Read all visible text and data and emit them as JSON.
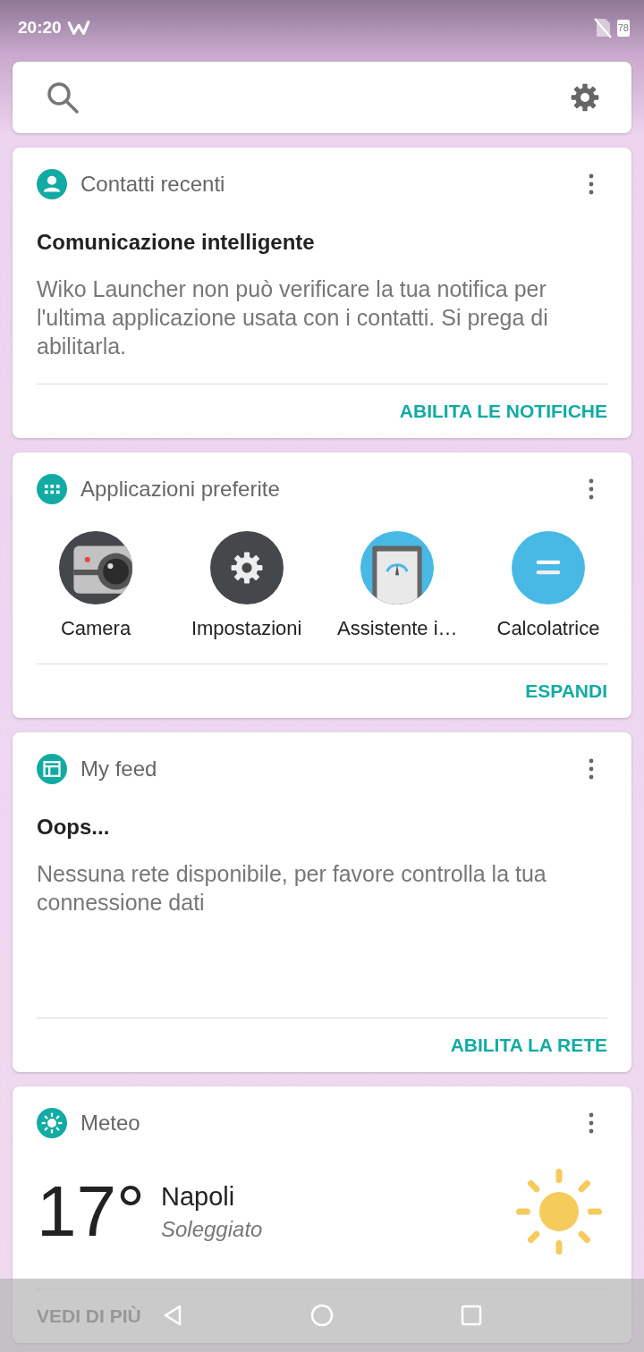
{
  "status_bar": {
    "time": "20:20",
    "battery": "78"
  },
  "cards": [
    {
      "kind": "contacts",
      "title": "Contatti recenti",
      "heading": "Comunicazione intelligente",
      "body": "Wiko Launcher non può verificare la tua notifica per l'ultima applicazione usata con i contatti. Si prega di abilitarla.",
      "action": "ABILITA LE NOTIFICHE"
    },
    {
      "kind": "apps",
      "title": "Applicazioni preferite",
      "apps": [
        {
          "kind": "camera",
          "label": "Camera"
        },
        {
          "kind": "settings",
          "label": "Impostazioni"
        },
        {
          "kind": "gauge",
          "label": "Assistente i…"
        },
        {
          "kind": "calculator",
          "label": "Calcolatrice"
        }
      ],
      "action": "ESPANDI"
    },
    {
      "kind": "feed",
      "title": "My feed",
      "heading": "Oops...",
      "body": "Nessuna rete disponibile, per favore controlla la tua connessione dati",
      "action": "ABILITA LA RETE"
    },
    {
      "kind": "weather",
      "title": "Meteo",
      "temperature": "17°",
      "city": "Napoli",
      "condition": "Soleggiato",
      "action": "VEDI DI PIÙ"
    }
  ]
}
